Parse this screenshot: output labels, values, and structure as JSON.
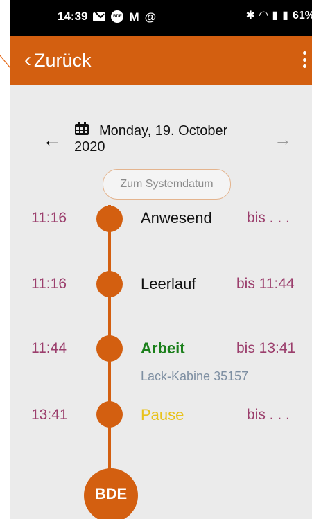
{
  "status_bar": {
    "time": "14:39",
    "battery": "61%"
  },
  "app_bar": {
    "back_label": "Zurück"
  },
  "date_nav": {
    "date_text": "Monday, 19. October 2020"
  },
  "system_date_button": "Zum Systemdatum",
  "timeline": [
    {
      "time": "11:16",
      "label": "Anwesend",
      "until": "bis . . .",
      "sub": "",
      "label_color": "#111111"
    },
    {
      "time": "11:16",
      "label": "Leerlauf",
      "until": "bis 11:44",
      "sub": "",
      "label_color": "#111111"
    },
    {
      "time": "11:44",
      "label": "Arbeit",
      "until": "bis 13:41",
      "sub": "Lack-Kabine 35157",
      "label_color": "#1a7f1a"
    },
    {
      "time": "13:41",
      "label": "Pause",
      "until": "bis . . .",
      "sub": "",
      "label_color": "#e8c21b"
    }
  ],
  "fab": {
    "label": "BDE"
  },
  "colors": {
    "accent": "#d35f10",
    "time_color": "#9b3e6c"
  }
}
